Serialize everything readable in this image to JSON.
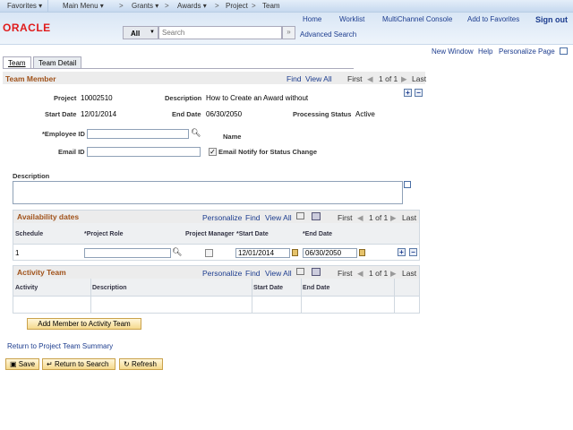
{
  "nav": {
    "favorites": "Favorites ▾",
    "main_menu": "Main Menu ▾",
    "bc1": "Grants ▾",
    "bc2": "Awards ▾",
    "bc3": "Project",
    "bc4": "Team",
    "sep": ">"
  },
  "header": {
    "logo": "ORACLE",
    "home": "Home",
    "worklist": "Worklist",
    "multichannel": "MultiChannel Console",
    "add_fav": "Add to Favorites",
    "sign_out": "Sign out",
    "search_scope": "All",
    "search_placeholder": "Search",
    "advanced": "Advanced Search"
  },
  "utility": {
    "new_window": "New Window",
    "help": "Help",
    "personalize": "Personalize Page"
  },
  "tabs": [
    {
      "label": "Team"
    },
    {
      "label": "Team Detail"
    }
  ],
  "team_member": {
    "title": "Team Member",
    "find": "Find",
    "view_all": "View All",
    "first": "First",
    "count": "1 of 1",
    "last": "Last"
  },
  "fields": {
    "project_label": "Project",
    "project": "10002510",
    "desc_label": "Description",
    "desc": "How to Create an Award without",
    "start_label": "Start Date",
    "start": "12/01/2014",
    "end_label": "End Date",
    "end": "06/30/2050",
    "status_label": "Processing Status",
    "status": "Active",
    "employee_label": "*Employee ID",
    "employee": "",
    "name_label": "Name",
    "email_label": "Email ID",
    "email": "",
    "notify_label": "Email Notify for Status Change",
    "notify_checked": true,
    "description_label": "Description",
    "description": ""
  },
  "availability": {
    "title": "Availability dates",
    "personalize": "Personalize",
    "find": "Find",
    "view_all": "View All",
    "first": "First",
    "count": "1 of 1",
    "last": "Last",
    "columns": [
      "Schedule",
      "*Project Role",
      "Project Manager",
      "*Start Date",
      "*End Date"
    ],
    "rows": [
      {
        "schedule": "1",
        "role": "",
        "manager": false,
        "start": "12/01/2014",
        "end": "06/30/2050"
      }
    ]
  },
  "activity": {
    "title": "Activity Team",
    "personalize": "Personalize",
    "find": "Find",
    "view_all": "View All",
    "first": "First",
    "count": "1 of 1",
    "last": "Last",
    "columns": [
      "Activity",
      "Description",
      "Start Date",
      "End Date"
    ]
  },
  "add_member": "Add Member to Activity Team",
  "return_link": "Return to Project Team Summary",
  "buttons": {
    "save": "Save",
    "return": "Return to Search",
    "refresh": "Refresh"
  }
}
